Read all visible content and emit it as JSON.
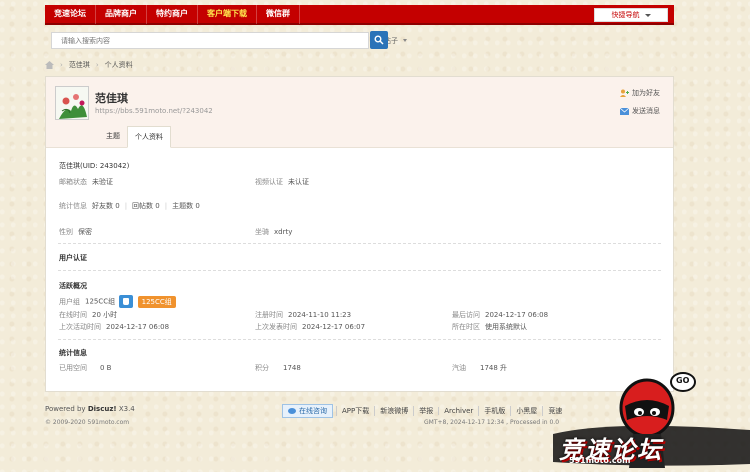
{
  "topnav": {
    "items": [
      "竞速论坛",
      "品牌商户",
      "特约商户",
      "客户端下载",
      "微信群"
    ],
    "quick_nav": "快捷导航"
  },
  "search": {
    "placeholder": "请输入搜索内容",
    "type": "帖子"
  },
  "breadcrumb": [
    "范佳琪",
    "个人资料"
  ],
  "profile": {
    "name": "范佳琪",
    "url": "https://bbs.591moto.net/?243042",
    "add_friend": "加为好友",
    "send_message": "发送消息",
    "tabs": [
      "主题",
      "个人资料"
    ],
    "uid_line": "范佳琪(UID: 243042)",
    "email_status_label": "邮箱状态",
    "email_status": "未验证",
    "video_auth_label": "视频认证",
    "video_auth": "未认证",
    "stats_label": "统计信息",
    "friends": "好友数 0",
    "replies": "回帖数 0",
    "threads": "主题数 0",
    "gender_label": "性别",
    "gender": "保密",
    "ride_label": "坐骑",
    "ride": "xdrty",
    "user_auth": "用户认证",
    "activity_title": "活跃概况",
    "group_label": "用户组",
    "group": "125CC组",
    "group_badge": "125CC组",
    "online_label": "在线时间",
    "online": "20 小时",
    "reg_label": "注册时间",
    "reg": "2024-11-10 11:23",
    "last_visit_label": "最后访问",
    "last_visit": "2024-12-17 06:08",
    "last_active_label": "上次活动时间",
    "last_active": "2024-12-17 06:08",
    "last_post_label": "上次发表时间",
    "last_post": "2024-12-17 06:07",
    "timezone_label": "所在时区",
    "timezone": "使用系统默认",
    "stat_title": "统计信息",
    "space_label": "已用空间",
    "space": "0 B",
    "points_label": "积分",
    "points": "1748",
    "sweat_label": "汽油",
    "sweat": "1748 升"
  },
  "footer": {
    "powered": "Powered by",
    "discuz": "Discuz!",
    "version": "X3.4",
    "copyright": "© 2009-2020 591moto.com",
    "consult": "在线咨询",
    "links": [
      "APP下载",
      "新浪微博",
      "举报",
      "Archiver",
      "手机版",
      "小黑屋",
      "竞速"
    ],
    "gmt": "GMT+8, 2024-12-17 12:34 , Processed in 0.0"
  },
  "logo": {
    "text": "竞速论坛",
    "site": "591moto.com",
    "go": "GO"
  }
}
